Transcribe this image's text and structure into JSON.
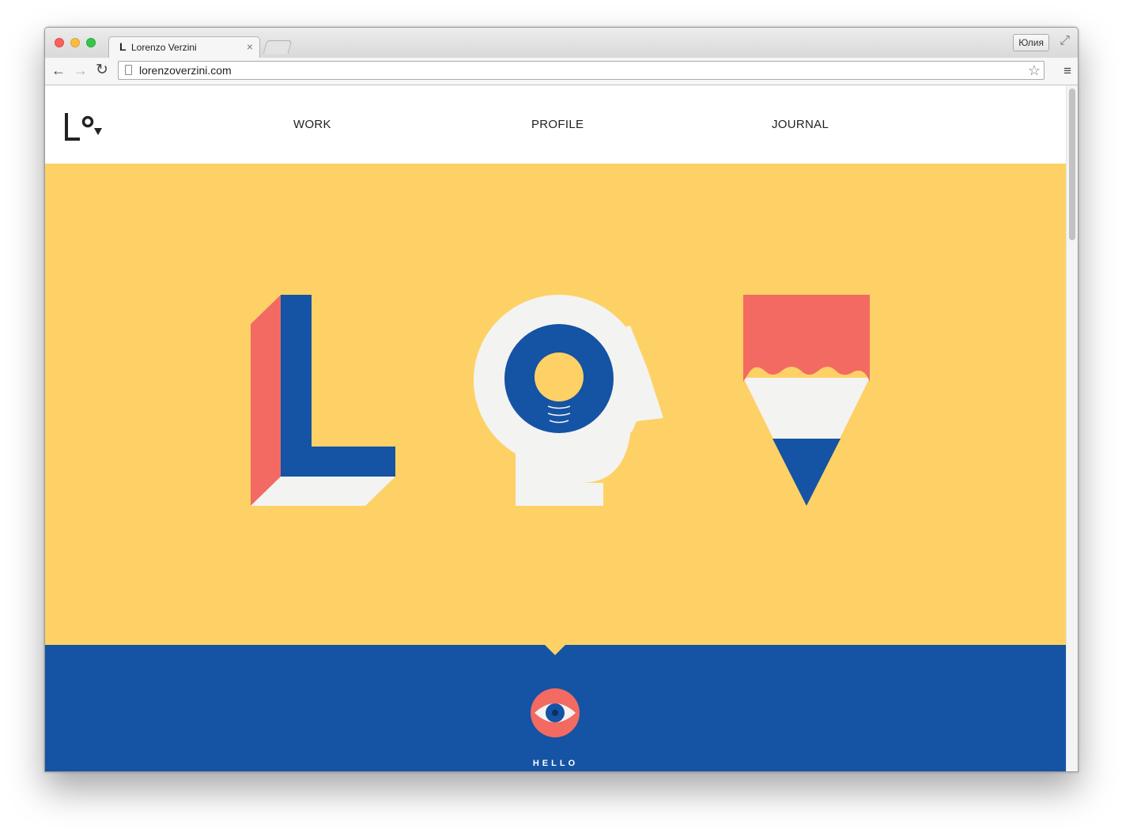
{
  "browser": {
    "tab_title": "Lorenzo Verzini",
    "tab_favicon": "L",
    "url": "lorenzoverzini.com",
    "profile_name": "Юлия"
  },
  "site": {
    "nav": [
      {
        "label": "WORK"
      },
      {
        "label": "PROFILE"
      },
      {
        "label": "JOURNAL"
      }
    ],
    "hello_label": "HELLO"
  },
  "colors": {
    "yellow": "#fdd165",
    "blue": "#1553a4",
    "coral": "#f26a62",
    "off_white": "#f3f3f2"
  }
}
